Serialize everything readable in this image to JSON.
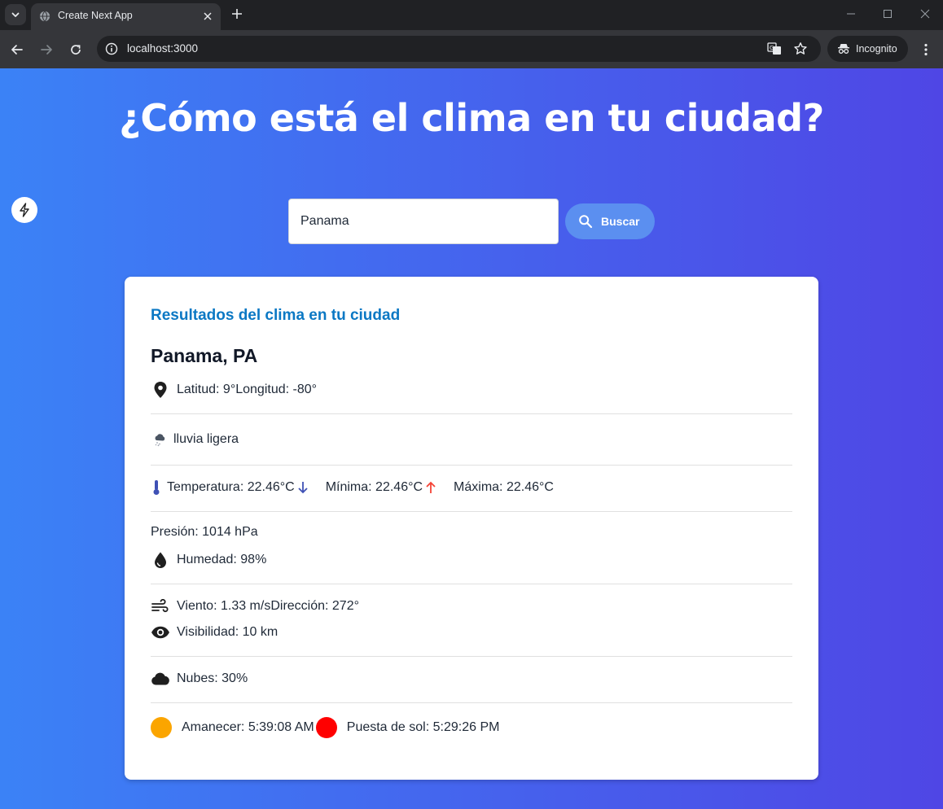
{
  "browser": {
    "tab_title": "Create Next App",
    "url": "localhost:3000",
    "incognito_label": "Incognito"
  },
  "page": {
    "headline": "¿Cómo está el clima en tu ciudad?",
    "search": {
      "value": "Panama",
      "button_label": "Buscar"
    },
    "results": {
      "title": "Resultados del clima en tu ciudad",
      "city": "Panama, PA",
      "coords": "Latitud: 9°Longitud: -80°",
      "description": "lluvia ligera",
      "temperature": "Temperatura: 22.46°C",
      "min": "Mínima: 22.46°C",
      "max": "Máxima: 22.46°C",
      "pressure": "Presión: 1014 hPa",
      "humidity": "Humedad: 98%",
      "wind": "Viento: 1.33 m/sDirección: 272°",
      "visibility": "Visibilidad: 10 km",
      "clouds": "Nubes: 30%",
      "sunrise": "Amanecer: 5:39:08 AM",
      "sunset": "Puesta de sol: 5:29:26 PM"
    }
  },
  "colors": {
    "gradient_start": "#3b82f6",
    "gradient_end": "#4f46e5",
    "card_title": "#0b78c4",
    "sunrise_dot": "#fba500",
    "sunset_dot": "#ff0000",
    "min_arrow": "#3f51b5",
    "max_arrow": "#f44336"
  }
}
